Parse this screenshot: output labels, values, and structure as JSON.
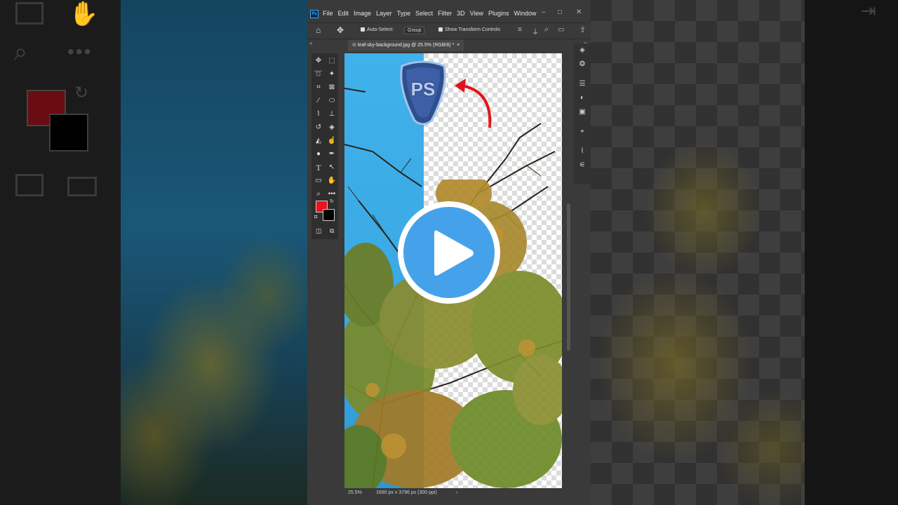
{
  "app": {
    "logo": "Ps",
    "menu": [
      "File",
      "Edit",
      "Image",
      "Layer",
      "Type",
      "Select",
      "Filter",
      "3D",
      "View",
      "Plugins",
      "Window"
    ],
    "window_controls": [
      "–",
      "□",
      "✕"
    ]
  },
  "options_bar": {
    "auto_select_label": "Auto-Select:",
    "group_value": "Group",
    "show_transform_label": "Show Transform Controls"
  },
  "document": {
    "tab_title": "leaf-sky-background.jpg @ 25.5% (RGB/8) *"
  },
  "status": {
    "zoom": "25.5%",
    "doc_info": "1690 px x 3796 px (300 ppi)"
  },
  "colors": {
    "foreground": "#e8141c",
    "background": "#000000",
    "accent": "#31a8ff",
    "play_button": "#45a2ea"
  },
  "overlay": {
    "badge_text": "PS"
  },
  "icons": {
    "tools": [
      "move-icon",
      "marquee-icon",
      "lasso-icon",
      "magic-wand-icon",
      "crop-icon",
      "frame-icon",
      "eyedropper-icon",
      "ellipse-icon",
      "brush-icon",
      "stamp-icon",
      "history-brush-icon",
      "eraser-icon",
      "paint-bucket-icon",
      "smudge-icon",
      "dodge-icon",
      "pen-icon",
      "type-icon",
      "path-select-icon",
      "rectangle-icon",
      "hand-icon",
      "zoom-icon",
      "more-icon"
    ],
    "panel": [
      "layers-icon",
      "channels-icon",
      "adjustments-icon",
      "color-icon",
      "swatches-icon",
      "paths-icon",
      "brush-settings-icon",
      "properties-icon"
    ]
  }
}
